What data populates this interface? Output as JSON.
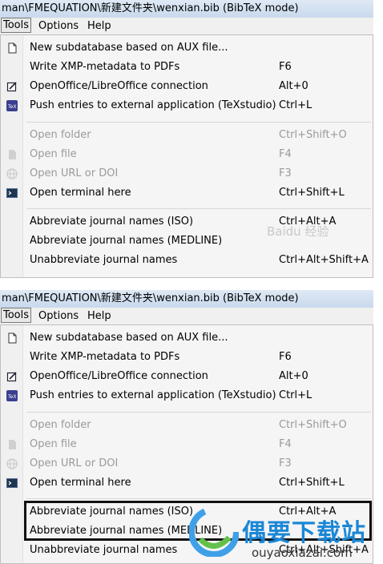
{
  "window": {
    "title": "man\\FMEQUATION\\新建文件夹\\wenxian.bib (BibTeX mode)"
  },
  "menubar": {
    "tools": "Tools",
    "options": "Options",
    "help": "Help"
  },
  "menu": {
    "new_subdatabase": {
      "label": "New subdatabase based on AUX file...",
      "shortcut": "",
      "icon": "document-icon"
    },
    "write_xmp": {
      "label": "Write XMP-metadata to PDFs",
      "shortcut": "F6"
    },
    "openoffice": {
      "label": "OpenOffice/LibreOffice connection",
      "shortcut": "Alt+0",
      "icon": "openoffice-icon"
    },
    "push_entries": {
      "label": "Push entries to external application (TeXstudio)",
      "shortcut": "Ctrl+L",
      "icon": "texstudio-icon"
    },
    "open_folder": {
      "label": "Open folder",
      "shortcut": "Ctrl+Shift+O",
      "disabled": true
    },
    "open_file": {
      "label": "Open file",
      "shortcut": "F4",
      "disabled": true,
      "icon": "file-icon"
    },
    "open_url": {
      "label": "Open URL or DOI",
      "shortcut": "F3",
      "disabled": true,
      "icon": "globe-icon"
    },
    "open_terminal": {
      "label": "Open terminal here",
      "shortcut": "Ctrl+Shift+L",
      "icon": "terminal-icon"
    },
    "abbrev_iso": {
      "label": "Abbreviate journal names (ISO)",
      "shortcut": "Ctrl+Alt+A"
    },
    "abbrev_medline": {
      "label": "Abbreviate journal names (MEDLINE)",
      "shortcut": ""
    },
    "unabbrev": {
      "label": "Unabbreviate journal names",
      "shortcut": "Ctrl+Alt+Shift+A"
    }
  },
  "watermark": {
    "baidu": "Baidu 经验",
    "site_title": "偶要下载站",
    "site_url": "ouyaoxiazai.com"
  },
  "colors": {
    "titlebar": "#d3e1f1",
    "menu_bg": "#f5f5f5",
    "disabled_text": "#9a9a9a",
    "watermark_blue": "#1a87d6"
  }
}
